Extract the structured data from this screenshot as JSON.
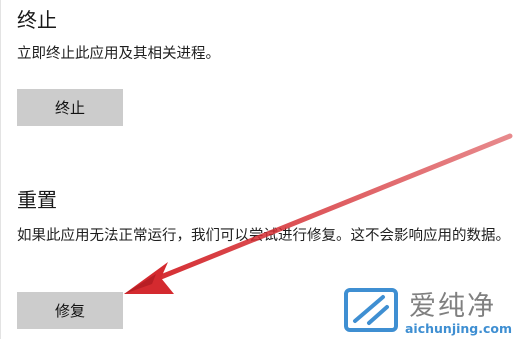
{
  "terminate": {
    "title": "终止",
    "description": "立即终止此应用及其相关进程。",
    "button_label": "终止"
  },
  "reset": {
    "title": "重置",
    "description": "如果此应用无法正常运行，我们可以尝试进行修复。这不会影响应用的数据。",
    "button_label": "修复"
  },
  "annotation": {
    "arrow_color": "#d42a2f",
    "arrow_icon": "red-pointer-arrow"
  },
  "watermark": {
    "brand_text": "爱纯净",
    "url": "aichunjing.com",
    "accent_color": "#3f8fd2"
  }
}
